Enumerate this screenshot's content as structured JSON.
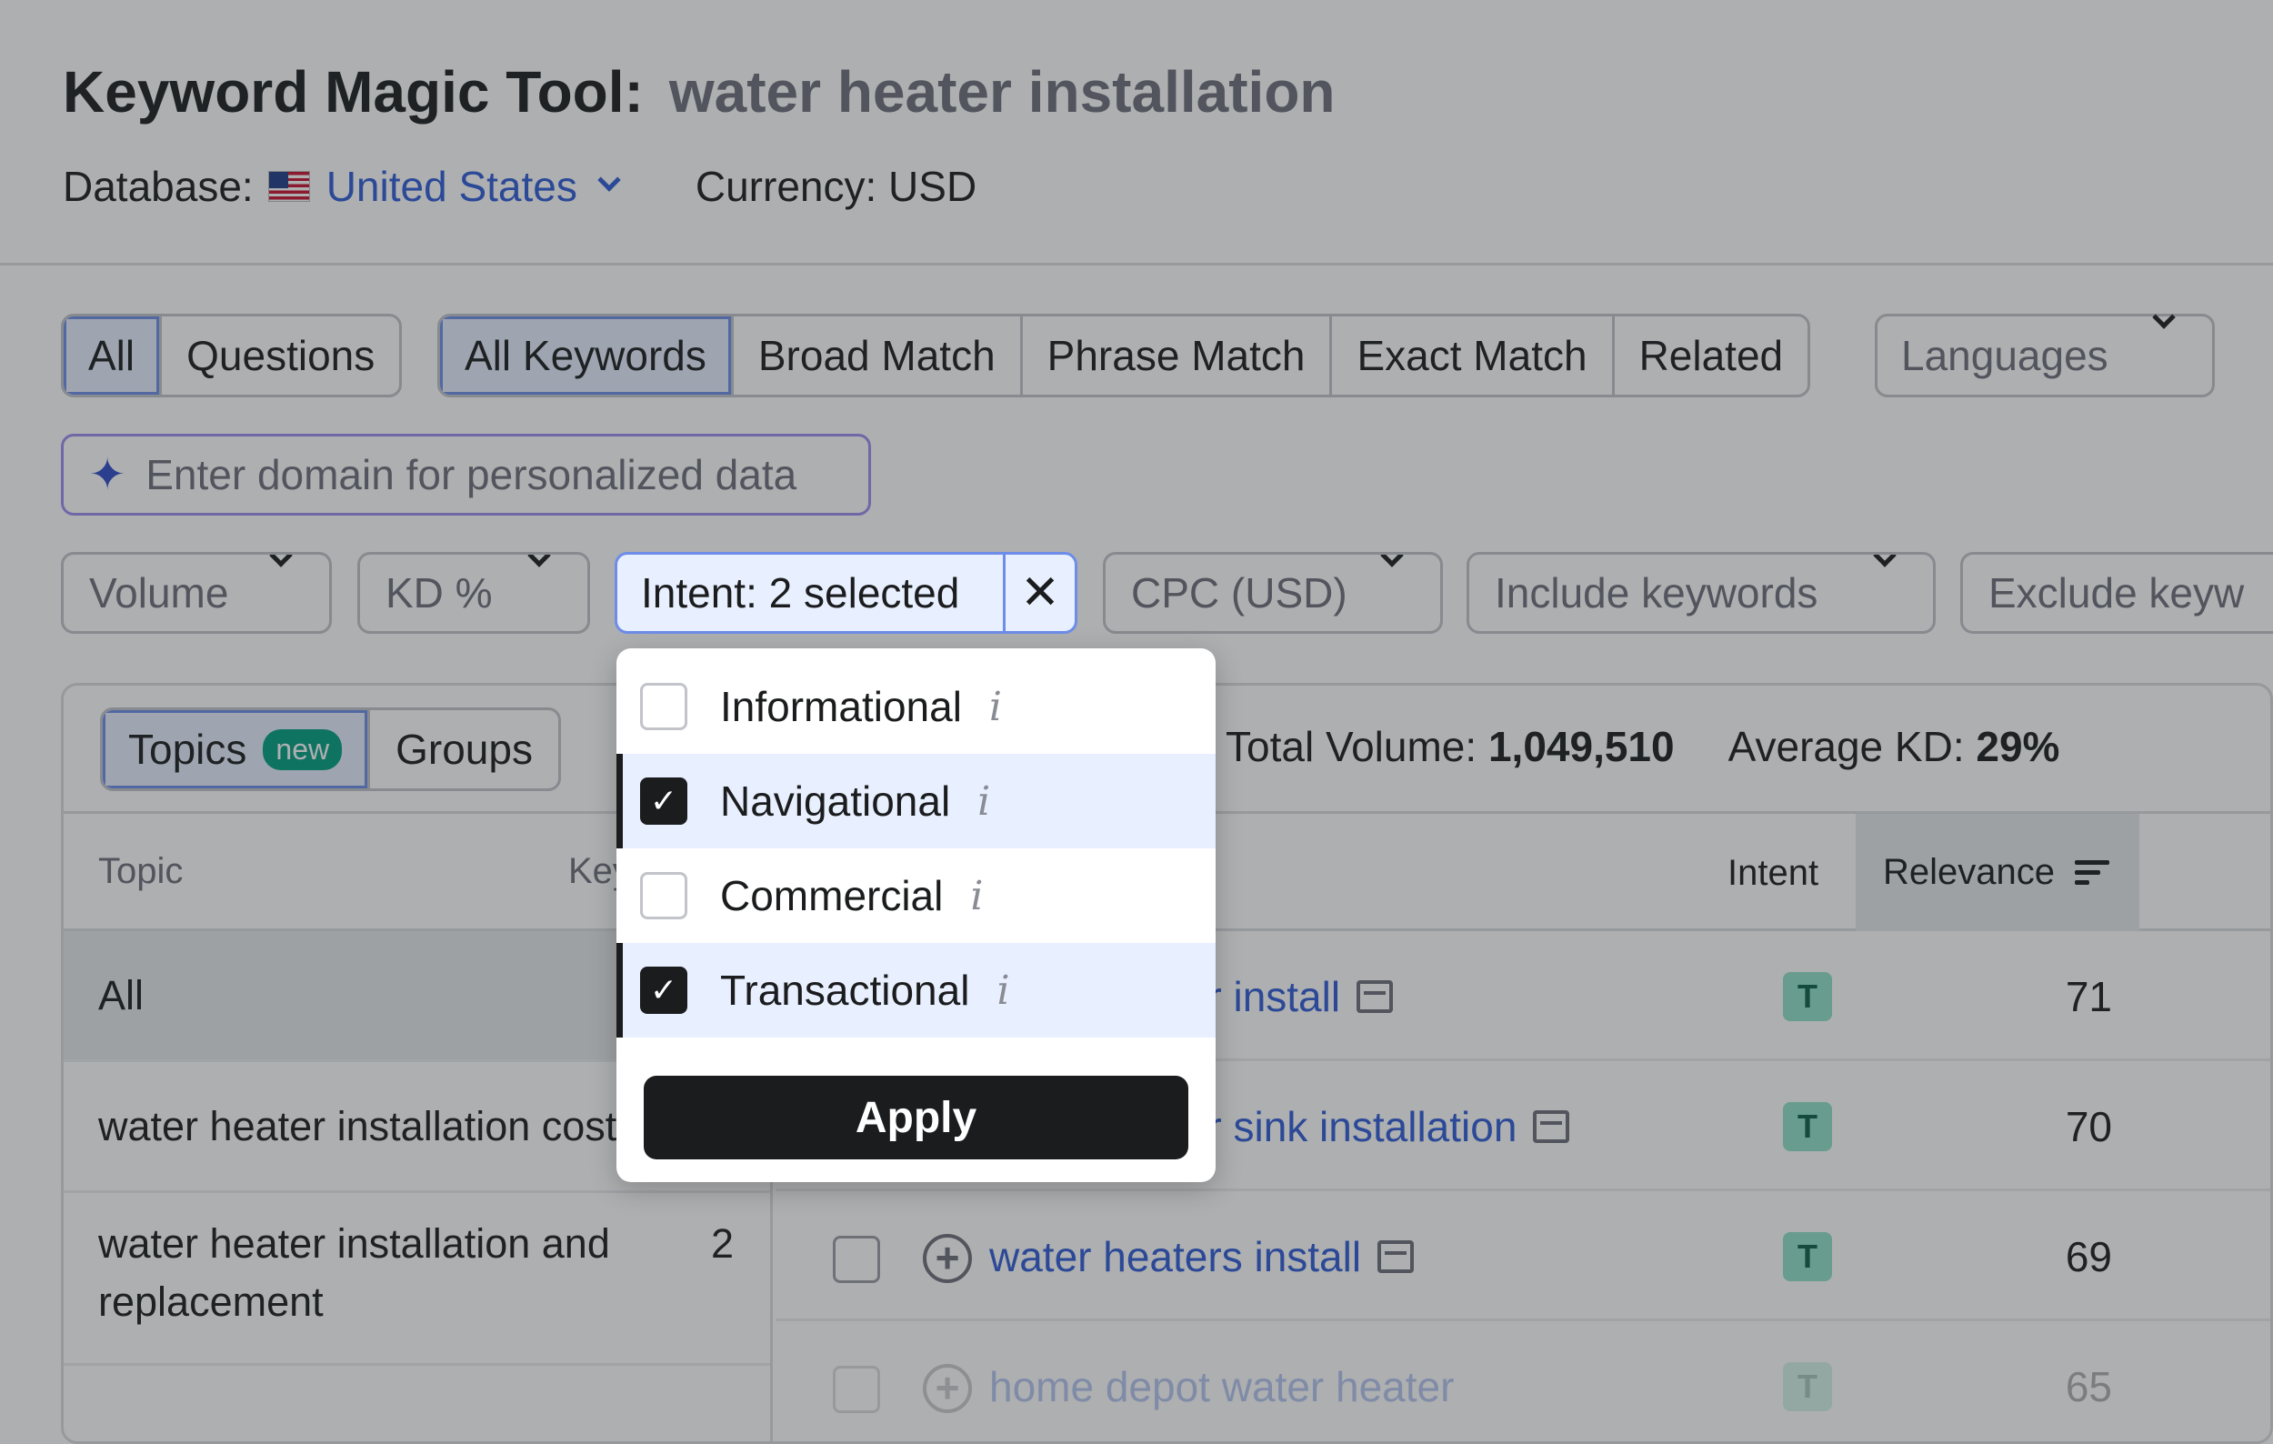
{
  "header": {
    "title": "Keyword Magic Tool:",
    "query": "water heater installation",
    "database_label": "Database:",
    "database_value": "United States",
    "currency": "Currency: USD"
  },
  "tabs_type": [
    "All",
    "Questions"
  ],
  "tabs_match": [
    "All Keywords",
    "Broad Match",
    "Phrase Match",
    "Exact Match",
    "Related"
  ],
  "languages_label": "Languages",
  "domain_placeholder": "Enter domain for personalized data",
  "filters": {
    "volume": "Volume",
    "kd": "KD %",
    "intent": "Intent: 2 selected",
    "intent_clear": "✕",
    "cpc": "CPC (USD)",
    "include": "Include keywords",
    "exclude": "Exclude keyw"
  },
  "intent_dropdown": {
    "options": [
      {
        "label": "Informational",
        "checked": false
      },
      {
        "label": "Navigational",
        "checked": true
      },
      {
        "label": "Commercial",
        "checked": false
      },
      {
        "label": "Transactional",
        "checked": true
      }
    ],
    "info_glyph": "i",
    "apply_label": "Apply"
  },
  "topics_tabs": {
    "topics": "Topics",
    "new_badge": "new",
    "groups": "Groups"
  },
  "stats": {
    "total_volume_label": "Total Volume:",
    "total_volume": "1,049,510",
    "avg_kd_label": "Average KD:",
    "avg_kd": "29%"
  },
  "left_table": {
    "headers": {
      "topic": "Topic",
      "keywords": "Key"
    },
    "rows": [
      {
        "topic": "All",
        "count": ""
      },
      {
        "topic": "water heater installation cost",
        "count": ""
      },
      {
        "topic": "water heater installation and replacement",
        "count": "2"
      }
    ]
  },
  "right_table": {
    "headers": {
      "intent": "Intent",
      "relevance": "Relevance"
    },
    "rows": [
      {
        "keyword": "water heater install",
        "intent": "T",
        "relevance": "71"
      },
      {
        "keyword": "water heater sink installation",
        "intent": "T",
        "relevance": "70"
      },
      {
        "keyword": "water heaters install",
        "intent": "T",
        "relevance": "69"
      },
      {
        "keyword": "home depot water heater",
        "intent": "T",
        "relevance": "65"
      }
    ]
  },
  "colors": {
    "accent_blue": "#2f5bd7",
    "intent_t": "#8fe0c8",
    "new_badge": "#009f81"
  }
}
